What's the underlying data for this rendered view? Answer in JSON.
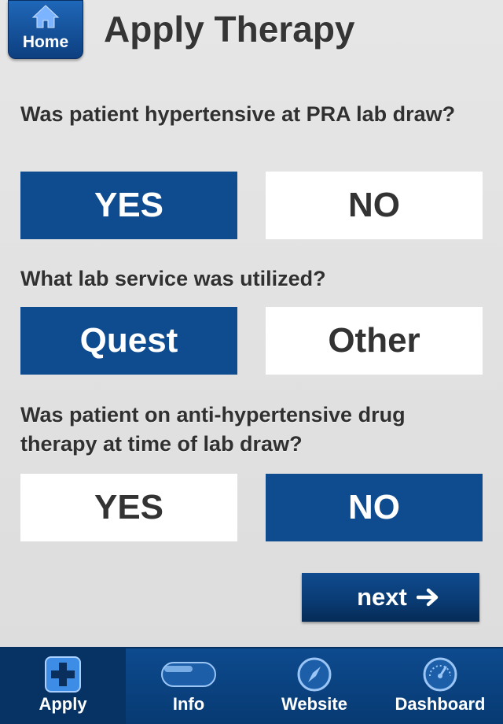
{
  "header": {
    "home_label": "Home",
    "title": "Apply Therapy"
  },
  "questions": [
    {
      "text": "Was patient hypertensive at PRA lab draw?",
      "options": [
        {
          "label": "YES",
          "selected": true
        },
        {
          "label": "NO",
          "selected": false
        }
      ]
    },
    {
      "text": "What lab service was utilized?",
      "options": [
        {
          "label": "Quest",
          "selected": true
        },
        {
          "label": "Other",
          "selected": false
        }
      ]
    },
    {
      "text": "Was patient on anti-hypertensive drug therapy at time of lab draw?",
      "options": [
        {
          "label": "YES",
          "selected": false
        },
        {
          "label": "NO",
          "selected": true
        }
      ]
    }
  ],
  "next_label": "next",
  "tabs": [
    {
      "label": "Apply",
      "icon": "plus-icon",
      "active": true
    },
    {
      "label": "Info",
      "icon": "capsule-icon",
      "active": false
    },
    {
      "label": "Website",
      "icon": "compass-icon",
      "active": false
    },
    {
      "label": "Dashboard",
      "icon": "gauge-icon",
      "active": false
    }
  ],
  "colors": {
    "brand_blue": "#0f4b8f",
    "background": "#dcdcdc",
    "text": "#333333"
  }
}
